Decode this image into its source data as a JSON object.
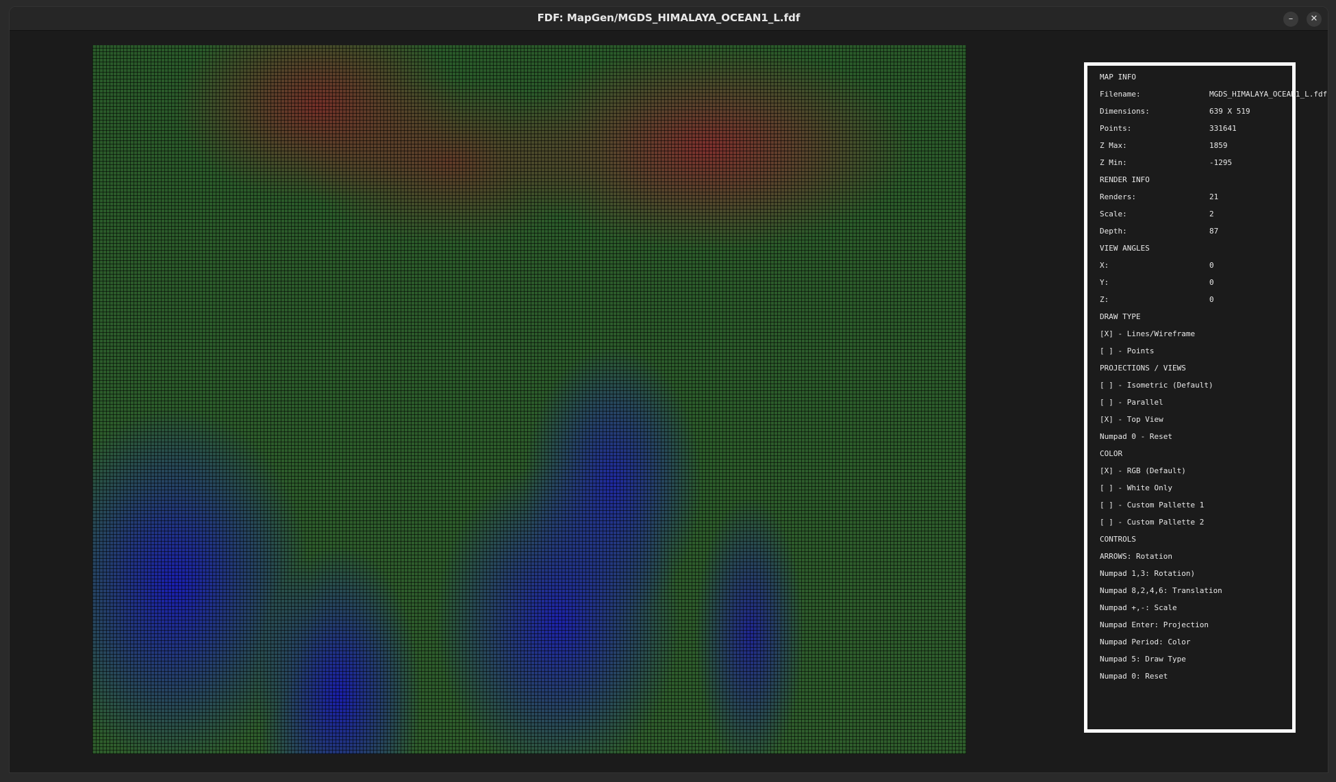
{
  "window": {
    "title": "FDF: MapGen/MGDS_HIMALAYA_OCEAN1_L.fdf",
    "minimize_glyph": "–",
    "close_glyph": "✕"
  },
  "panel": {
    "map_info": {
      "heading": "MAP INFO",
      "filename_label": "Filename:",
      "filename_value": "MGDS_HIMALAYA_OCEAN1_L.fdf",
      "dimensions_label": "Dimensions:",
      "dimensions_value": "639 X 519",
      "points_label": "Points:",
      "points_value": "331641",
      "zmax_label": "Z Max:",
      "zmax_value": "1859",
      "zmin_label": "Z Min:",
      "zmin_value": "-1295"
    },
    "render_info": {
      "heading": "RENDER INFO",
      "renders_label": "Renders:",
      "renders_value": "21",
      "scale_label": "Scale:",
      "scale_value": "2",
      "depth_label": "Depth:",
      "depth_value": "87"
    },
    "view_angles": {
      "heading": "VIEW ANGLES",
      "x_label": "X:",
      "x_value": "0",
      "y_label": "Y:",
      "y_value": "0",
      "z_label": "Z:",
      "z_value": "0"
    },
    "draw_type": {
      "heading": "DRAW TYPE",
      "items": [
        "[X] - Lines/Wireframe",
        "[ ] - Points"
      ]
    },
    "projections": {
      "heading": "PROJECTIONS / VIEWS",
      "items": [
        "[ ] - Isometric (Default)",
        "[ ] - Parallel",
        "[X] - Top View",
        "Numpad 0 - Reset"
      ]
    },
    "color": {
      "heading": "COLOR",
      "items": [
        "[X] - RGB (Default)",
        "[ ] - White Only",
        "[ ] - Custom Pallette 1",
        "[ ] - Custom Pallette 2"
      ]
    },
    "controls": {
      "heading": "CONTROLS",
      "items": [
        "ARROWS: Rotation",
        "Numpad 1,3: Rotation)",
        "Numpad 8,2,4,6: Translation",
        "Numpad +,-: Scale",
        "Numpad Enter: Projection",
        "Numpad Period: Color",
        "Numpad 5: Draw Type",
        "Numpad 0: Reset"
      ]
    }
  },
  "colors": {
    "high": "#7a2d28",
    "mid": "#2e5c2c",
    "low": "#1e22aa",
    "panel_border": "#ffffff"
  }
}
